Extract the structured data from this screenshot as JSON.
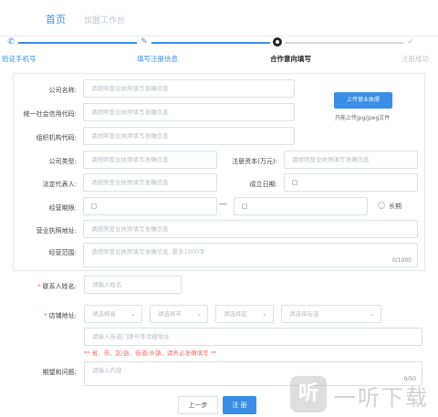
{
  "nav": {
    "home": "首页",
    "join": "加盟工作台"
  },
  "steps": [
    {
      "label": "验证手机号",
      "icon": "phone-icon",
      "state": "done"
    },
    {
      "label": "填写注册信息",
      "icon": "pen-icon",
      "state": "done"
    },
    {
      "label": "合作意向填写",
      "icon": "target-icon",
      "state": "active"
    },
    {
      "label": "注册成功",
      "icon": "check-icon",
      "state": "pending"
    }
  ],
  "company": {
    "name_label": "公司名称:",
    "name_ph": "请按照营业执照填写准确信息",
    "credit_label": "统一社会信用代码:",
    "credit_ph": "请按照营业执照填写准确信息",
    "org_label": "组织机构代码:",
    "org_ph": "请按照营业执照填写准确信息",
    "type_label": "公司类型:",
    "type_ph": "请按照营业执照填写准确信息",
    "capital_label": "注册资本(万元):",
    "capital_ph": "请按照营业执照填写准确信息",
    "legal_label": "法定代表人:",
    "legal_ph": "请按照营业执照填写准确信息",
    "founded_label": "成立日期:",
    "term_label": "经营期限:",
    "term_dash": "—",
    "longterm_label": "长期",
    "address_label": "营业执照地址:",
    "address_ph": "请按照营业执照填写准确信息",
    "scope_label": "经营范围:",
    "scope_ph": "请按照营业执照填写准确信息, 最多1000字",
    "scope_counter": "0/1000"
  },
  "upload": {
    "button": "上传营业执照",
    "tip": "只能上传jpg/jpeg文件"
  },
  "contact": {
    "label": "联系人姓名:",
    "ph": "请输入姓名"
  },
  "store": {
    "label": "店铺地址:",
    "province_ph": "请选择省",
    "city_ph": "请选择市",
    "district_ph": "请选择区",
    "street_ph": "请选择街道",
    "detail_ph": "请输入街道门牌号等详细地址",
    "error": "** 省、市、区/县、街道/乡镇，请务必准确填写 **"
  },
  "wish": {
    "label": "期望和问题:",
    "ph": "请输入内容",
    "counter": "0/50"
  },
  "buttons": {
    "prev": "上一步",
    "register": "注 册"
  },
  "watermark": {
    "logo": "听",
    "text": "一听下载"
  },
  "colors": {
    "accent": "#3a8ee6",
    "error": "#f56c6c",
    "border": "#dcdfe6"
  }
}
